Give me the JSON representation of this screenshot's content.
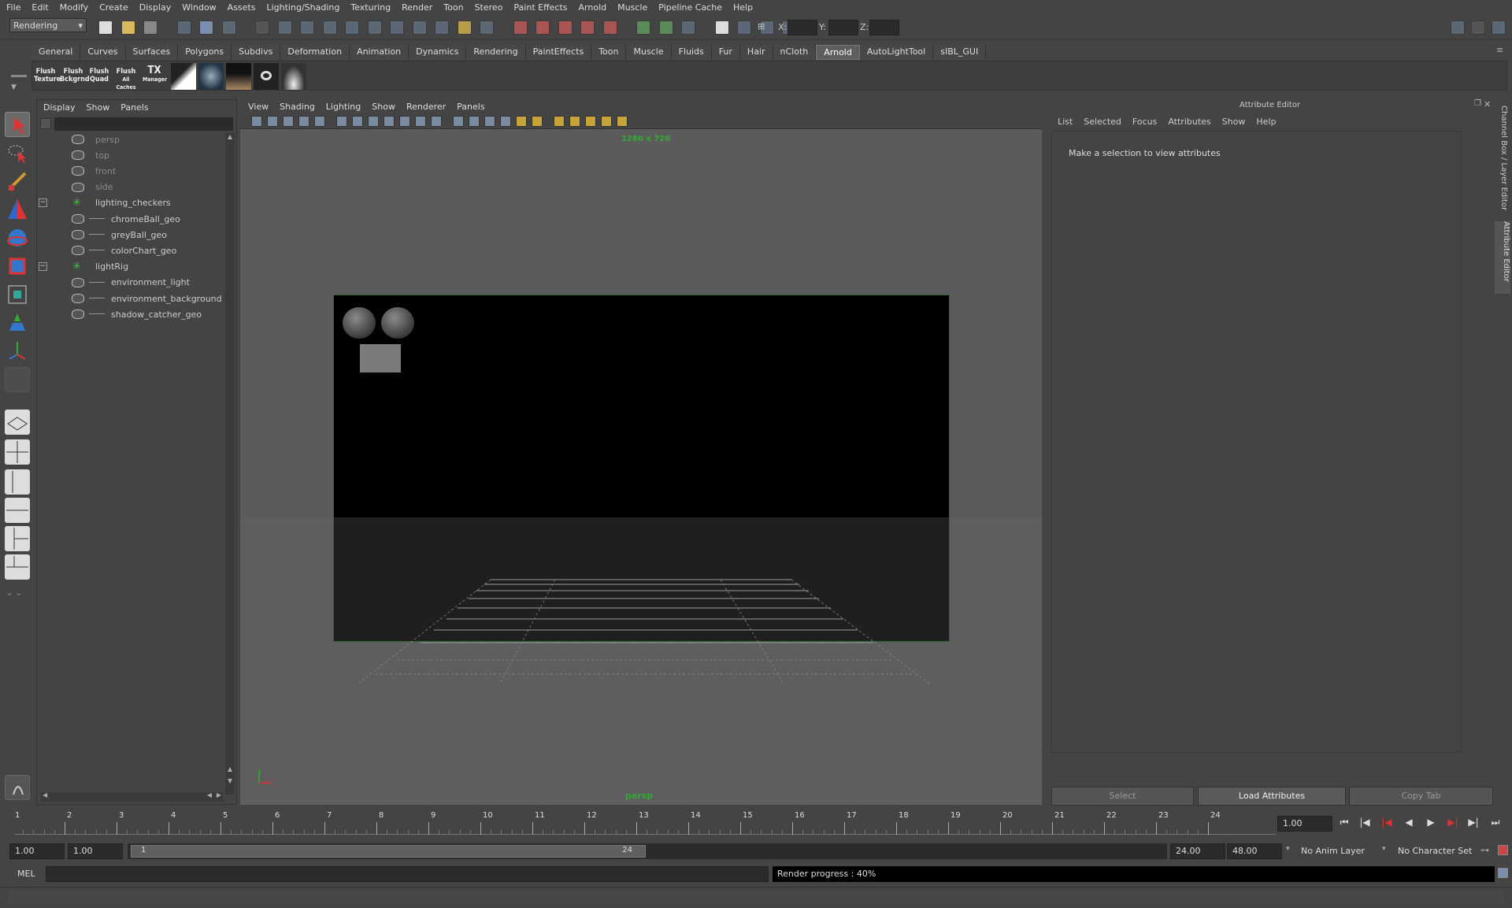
{
  "menubar": [
    "File",
    "Edit",
    "Modify",
    "Create",
    "Display",
    "Window",
    "Assets",
    "Lighting/Shading",
    "Texturing",
    "Render",
    "Toon",
    "Stereo",
    "Paint Effects",
    "Arnold",
    "Muscle",
    "Pipeline Cache",
    "Help"
  ],
  "status_line": {
    "menu_set": "Rendering",
    "x_label": "X:",
    "y_label": "Y:",
    "z_label": "Z:"
  },
  "shelf_tabs": [
    "General",
    "Curves",
    "Surfaces",
    "Polygons",
    "Subdivs",
    "Deformation",
    "Animation",
    "Dynamics",
    "Rendering",
    "PaintEffects",
    "Toon",
    "Muscle",
    "Fluids",
    "Fur",
    "Hair",
    "nCloth",
    "Arnold",
    "AutoLightTool",
    "sIBL_GUI"
  ],
  "active_shelf_tab": "Arnold",
  "shelf_buttons": [
    {
      "line1": "Flush",
      "line2": "Texture"
    },
    {
      "line1": "Flush",
      "line2": "Bckgrnd"
    },
    {
      "line1": "Flush",
      "line2": "Quad"
    },
    {
      "line1": "Flush",
      "line2": "All Caches"
    },
    {
      "line1": "TX",
      "line2": "Manager"
    }
  ],
  "outliner": {
    "menu": [
      "Display",
      "Show",
      "Panels"
    ],
    "items": [
      {
        "label": "persp",
        "dim": true
      },
      {
        "label": "top",
        "dim": true
      },
      {
        "label": "front",
        "dim": true
      },
      {
        "label": "side",
        "dim": true
      },
      {
        "label": "lighting_checkers",
        "group": true
      },
      {
        "label": "chromeBall_geo",
        "child": true
      },
      {
        "label": "greyBall_geo",
        "child": true
      },
      {
        "label": "colorChart_geo",
        "child": true
      },
      {
        "label": "lightRig",
        "group": true
      },
      {
        "label": "environment_light",
        "child": true
      },
      {
        "label": "environment_background",
        "child": true
      },
      {
        "label": "shadow_catcher_geo",
        "child": true
      }
    ]
  },
  "viewport": {
    "menu": [
      "View",
      "Shading",
      "Lighting",
      "Show",
      "Renderer",
      "Panels"
    ],
    "resolution": "1280 x 720",
    "camera": "persp",
    "axis_y": "y",
    "axis_x": "x"
  },
  "attribute_editor": {
    "title": "Attribute Editor",
    "menu": [
      "List",
      "Selected",
      "Focus",
      "Attributes",
      "Show",
      "Help"
    ],
    "message": "Make a selection to view attributes",
    "buttons": {
      "select": "Select",
      "load": "Load Attributes",
      "copy": "Copy Tab"
    },
    "side_tabs": [
      "Channel Box / Layer Editor",
      "Attribute Editor"
    ]
  },
  "timeline": {
    "ticks": [
      "1",
      "2",
      "3",
      "4",
      "5",
      "6",
      "7",
      "8",
      "9",
      "10",
      "11",
      "12",
      "13",
      "14",
      "15",
      "16",
      "17",
      "18",
      "19",
      "20",
      "21",
      "22",
      "23",
      "24"
    ],
    "current_frame": "1.00"
  },
  "range": {
    "start": "1.00",
    "playback_start": "1.00",
    "slider_start": "1",
    "slider_end": "24",
    "playback_end": "24.00",
    "end": "48.00",
    "anim_layer": "No Anim Layer",
    "character_set": "No Character Set"
  },
  "command_line": {
    "label": "MEL",
    "feedback": "Render progress : 40%"
  },
  "colors": {
    "accent": "#5e5e5e",
    "panel": "#444444",
    "field": "#2b2b2b"
  }
}
